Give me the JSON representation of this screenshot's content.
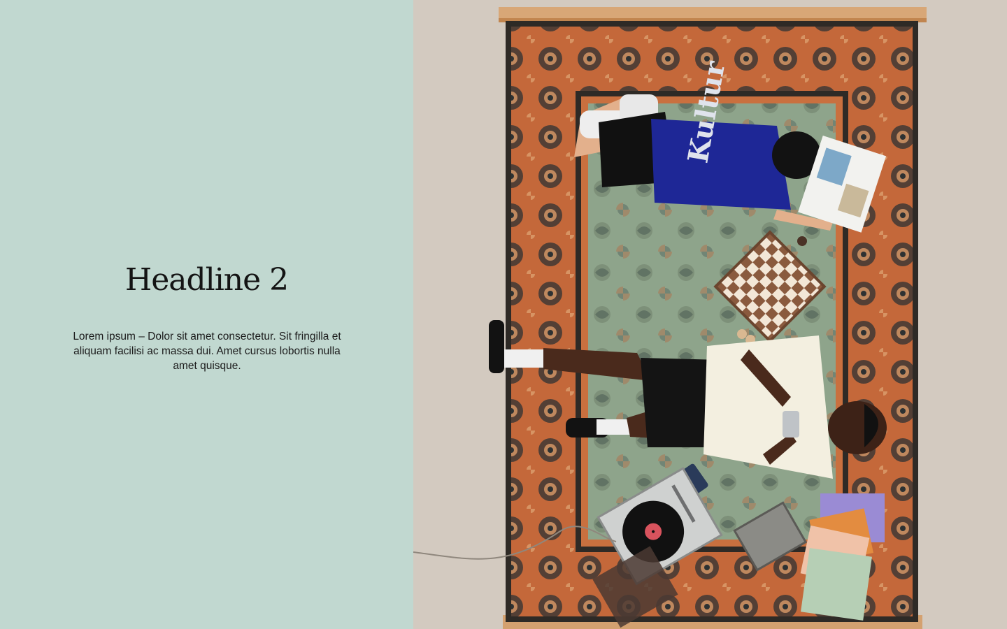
{
  "hero": {
    "headline": "Headline 2",
    "body": "Lorem ipsum – Dolor sit amet consectetur. Sit fringilla et aliquam facilisi ac massa dui. Amet cursus lobortis nulla amet quisque."
  },
  "image": {
    "description_icon": "photo-icon",
    "shirt_print": "Kultur"
  },
  "colors": {
    "panel_background": "#c1d8d0",
    "floor": "#d6cec4",
    "rug_border": "#c9703f",
    "rug_field": "#8fa58c",
    "text": "#141414"
  }
}
